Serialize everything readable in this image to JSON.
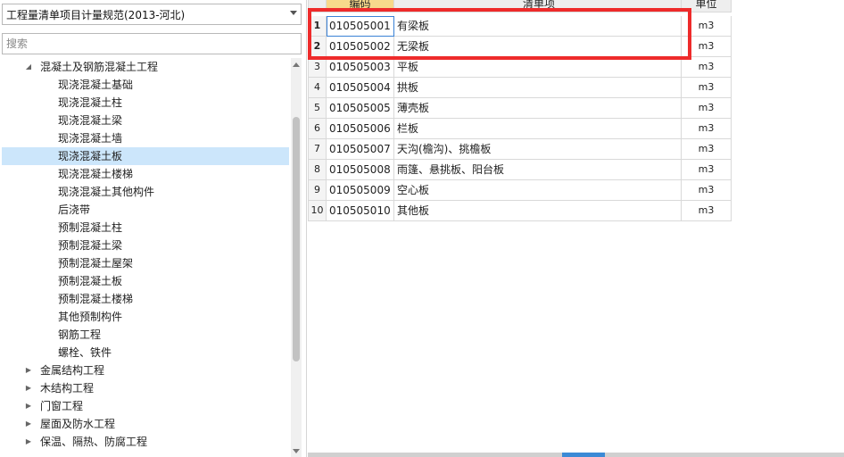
{
  "left_panel": {
    "spec_select_value": "工程量清单项目计量规范(2013-河北)",
    "search_placeholder": "搜索",
    "tree": [
      {
        "label": "混凝土及钢筋混凝土工程",
        "level": 1,
        "expanded": true
      },
      {
        "label": "现浇混凝土基础",
        "level": 2
      },
      {
        "label": "现浇混凝土柱",
        "level": 2
      },
      {
        "label": "现浇混凝土梁",
        "level": 2
      },
      {
        "label": "现浇混凝土墙",
        "level": 2
      },
      {
        "label": "现浇混凝土板",
        "level": 2,
        "selected": true
      },
      {
        "label": "现浇混凝土楼梯",
        "level": 2
      },
      {
        "label": "现浇混凝土其他构件",
        "level": 2
      },
      {
        "label": "后浇带",
        "level": 2
      },
      {
        "label": "预制混凝土柱",
        "level": 2
      },
      {
        "label": "预制混凝土梁",
        "level": 2
      },
      {
        "label": "预制混凝土屋架",
        "level": 2
      },
      {
        "label": "预制混凝土板",
        "level": 2
      },
      {
        "label": "预制混凝土楼梯",
        "level": 2
      },
      {
        "label": "其他预制构件",
        "level": 2
      },
      {
        "label": "钢筋工程",
        "level": 2
      },
      {
        "label": "螺栓、铁件",
        "level": 2
      },
      {
        "label": "金属结构工程",
        "level": 1,
        "expanded": false
      },
      {
        "label": "木结构工程",
        "level": 1,
        "expanded": false
      },
      {
        "label": "门窗工程",
        "level": 1,
        "expanded": false
      },
      {
        "label": "屋面及防水工程",
        "level": 1,
        "expanded": false
      },
      {
        "label": "保温、隔热、防腐工程",
        "level": 1,
        "expanded": false
      }
    ]
  },
  "grid": {
    "headers": {
      "code": "编码",
      "name": "清单项",
      "unit": "单位"
    },
    "rows": [
      {
        "idx": "1",
        "code": "010505001",
        "name": "有梁板",
        "unit": "m3"
      },
      {
        "idx": "2",
        "code": "010505002",
        "name": "无梁板",
        "unit": "m3"
      },
      {
        "idx": "3",
        "code": "010505003",
        "name": "平板",
        "unit": "m3"
      },
      {
        "idx": "4",
        "code": "010505004",
        "name": "拱板",
        "unit": "m3"
      },
      {
        "idx": "5",
        "code": "010505005",
        "name": "薄壳板",
        "unit": "m3"
      },
      {
        "idx": "6",
        "code": "010505006",
        "name": "栏板",
        "unit": "m3"
      },
      {
        "idx": "7",
        "code": "010505007",
        "name": "天沟(檐沟)、挑檐板",
        "unit": "m3"
      },
      {
        "idx": "8",
        "code": "010505008",
        "name": "雨篷、悬挑板、阳台板",
        "unit": "m3"
      },
      {
        "idx": "9",
        "code": "010505009",
        "name": "空心板",
        "unit": "m3"
      },
      {
        "idx": "10",
        "code": "010505010",
        "name": "其他板",
        "unit": "m3"
      }
    ]
  },
  "colors": {
    "selected_row": "#cce6fb",
    "highlight_box": "#ee2b2b",
    "active_header": "#f7d98b",
    "scroll_grip": "#3b8ad6"
  }
}
